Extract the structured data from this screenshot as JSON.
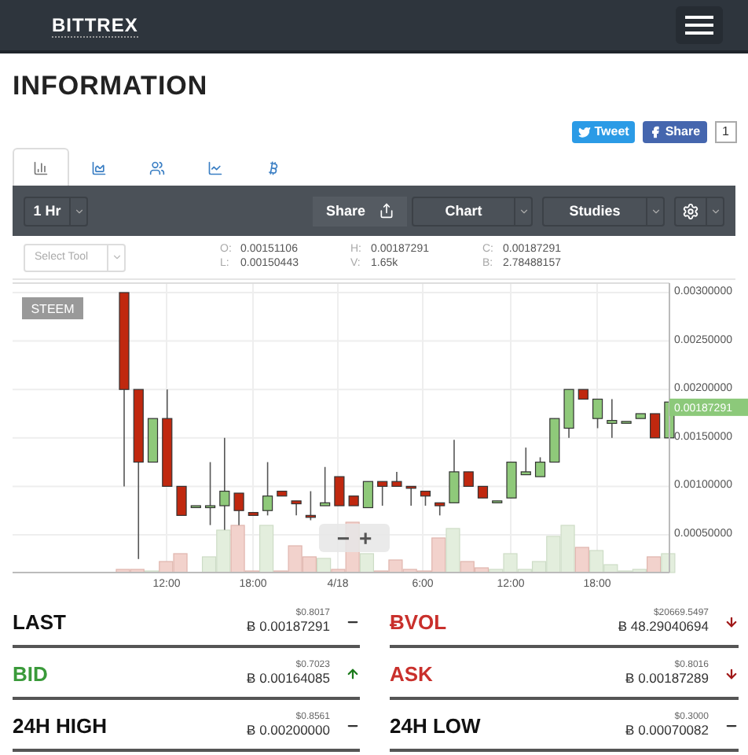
{
  "header": {
    "logo": "BITTREX"
  },
  "page_title": "INFORMATION",
  "social": {
    "tweet": "Tweet",
    "share": "Share",
    "share_count": "1"
  },
  "tabs": [
    {
      "selected": true
    },
    {
      "selected": false
    },
    {
      "selected": false
    },
    {
      "selected": false
    },
    {
      "selected": false
    }
  ],
  "toolbar": {
    "interval": "1 Hr",
    "share": "Share",
    "chart": "Chart",
    "studies": "Studies"
  },
  "ohlc": {
    "tool_placeholder": "Select Tool",
    "values": [
      {
        "key": "O:",
        "value": "0.00151106"
      },
      {
        "key": "L:",
        "value": "0.00150443"
      },
      {
        "key": "H:",
        "value": "0.00187291"
      },
      {
        "key": "V:",
        "value": "1.65k"
      },
      {
        "key": "C:",
        "value": "0.00187291"
      },
      {
        "key": "B:",
        "value": "2.78488157"
      }
    ]
  },
  "chart": {
    "symbol": "STEEM",
    "price_tag": "0.00187291",
    "zoom_out": "−",
    "zoom_in": "+",
    "y_labels": [
      "0.00300000",
      "0.00250000",
      "0.00200000",
      "0.00150000",
      "0.00100000",
      "0.00050000"
    ],
    "x_labels": [
      "12:00",
      "18:00",
      "4/18",
      "6:00",
      "12:00",
      "18:00"
    ]
  },
  "stats": [
    {
      "label": "LAST",
      "color": "#111111",
      "usd": "$0.8017",
      "btc": "Ƀ 0.00187291",
      "kind": "flat"
    },
    {
      "label": "ɃVOL",
      "color": "#c9302c",
      "usd": "$20669.5497",
      "btc": "Ƀ 48.29040694",
      "kind": "down"
    },
    {
      "label": "BID",
      "color": "#3a9a3a",
      "usd": "$0.7023",
      "btc": "Ƀ 0.00164085",
      "kind": "up"
    },
    {
      "label": "ASK",
      "color": "#c9302c",
      "usd": "$0.8016",
      "btc": "Ƀ 0.00187289",
      "kind": "down"
    },
    {
      "label": "24H HIGH",
      "color": "#111111",
      "usd": "$0.8561",
      "btc": "Ƀ 0.00200000",
      "kind": "flat"
    },
    {
      "label": "24H LOW",
      "color": "#111111",
      "usd": "$0.3000",
      "btc": "Ƀ 0.00070082",
      "kind": "flat"
    }
  ]
}
